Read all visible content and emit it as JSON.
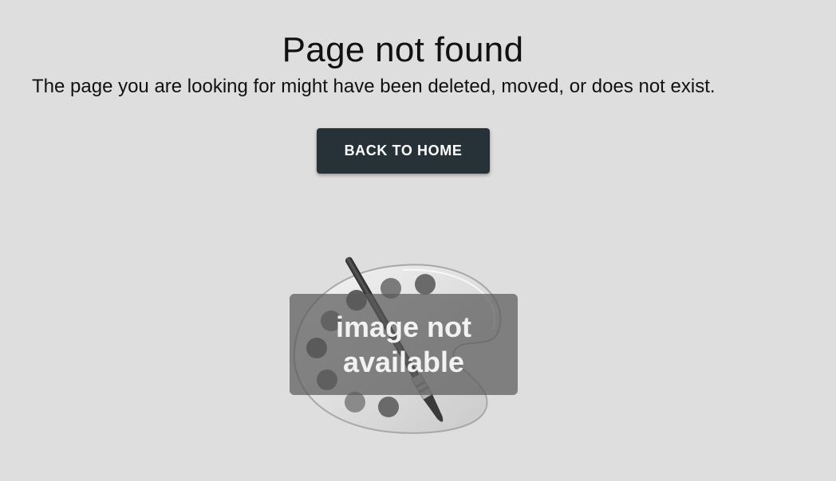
{
  "error": {
    "title": "Page not found",
    "message": "The page you are looking for might have been deleted, moved, or does not exist."
  },
  "actions": {
    "back_home_label": "BACK TO HOME"
  },
  "image_placeholder": {
    "icon": "palette-icon",
    "line1": "image not",
    "line2": "available"
  },
  "colors": {
    "background": "#dedede",
    "button": "#263238",
    "button_text": "#ffffff"
  }
}
